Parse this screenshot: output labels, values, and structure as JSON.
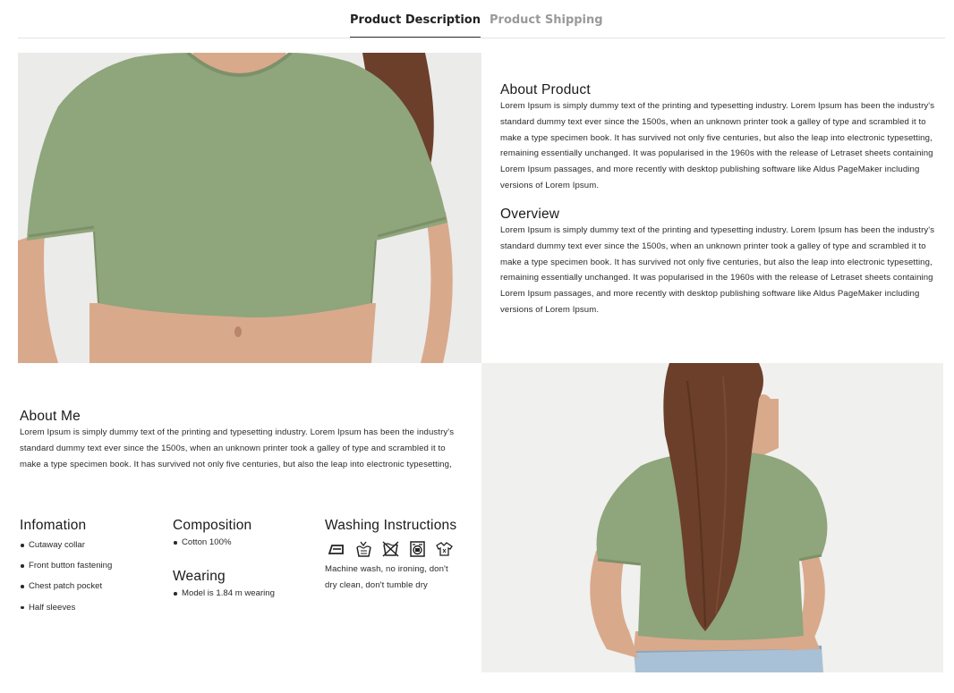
{
  "tabs": [
    {
      "label": "Product Description",
      "active": true
    },
    {
      "label": "Product Shipping",
      "active": false
    }
  ],
  "about_product": {
    "title": "About Product",
    "body": "Lorem Ipsum is simply dummy text of the printing and typesetting industry. Lorem Ipsum has been the industry's standard dummy text ever since the 1500s, when an unknown printer took a galley of type and scrambled it to make a type specimen book. It has survived not only five centuries, but also the leap into electronic typesetting, remaining essentially unchanged. It was popularised in the 1960s with the release of Letraset sheets containing Lorem Ipsum passages, and more recently with desktop publishing software like Aldus PageMaker including versions of Lorem Ipsum."
  },
  "overview": {
    "title": "Overview",
    "body": "Lorem Ipsum is simply dummy text of the printing and typesetting industry. Lorem Ipsum has been the industry's standard dummy text ever since the 1500s, when an unknown printer took a galley of type and scrambled it to make a type specimen book. It has survived not only five centuries, but also the leap into electronic typesetting, remaining essentially unchanged. It was popularised in the 1960s with the release of Letraset sheets containing Lorem Ipsum passages, and more recently with desktop publishing software like Aldus PageMaker including versions of Lorem Ipsum."
  },
  "about_me": {
    "title": "About Me",
    "body": "Lorem Ipsum is simply dummy text of the printing and typesetting industry. Lorem Ipsum has been the industry's standard dummy text ever since the 1500s, when an unknown printer took a galley of type and scrambled it to make a type specimen book. It has survived not only five centuries, but also the leap into electronic typesetting,"
  },
  "information": {
    "title": "Infomation",
    "items": [
      "Cutaway collar",
      "Front button fastening",
      "Chest patch pocket",
      "Half sleeves"
    ]
  },
  "composition": {
    "title": "Composition",
    "items": [
      "Cotton 100%"
    ]
  },
  "wearing": {
    "title": "Wearing",
    "items": [
      "Model is 1.84 m wearing"
    ]
  },
  "washing": {
    "title": "Washing Instructions",
    "icons": [
      "no-ironing-icon",
      "hand-wash-icon",
      "no-dry-clean-icon",
      "no-tumble-dry-icon",
      "machine-wash-icon"
    ],
    "text": "Machine wash, no ironing, don't dry clean, don't tumble dry"
  },
  "colors": {
    "tab_active": "#222222",
    "tab_inactive": "#9a9a9a",
    "shirt": "#8fa57c",
    "skin": "#d9a98c",
    "hair": "#6b3f2a",
    "jeans": "#a9c1d6"
  }
}
